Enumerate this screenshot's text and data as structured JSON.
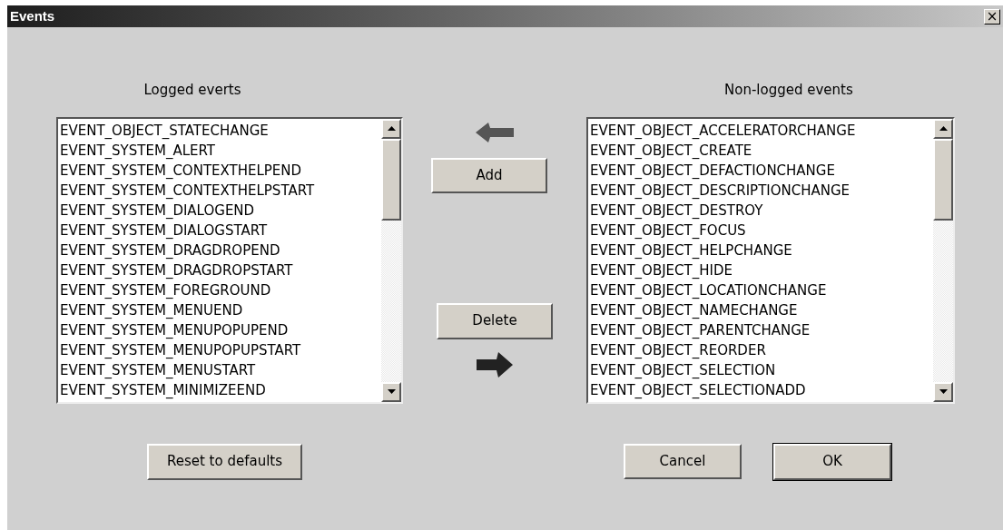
{
  "window": {
    "title": "Events",
    "close": "×"
  },
  "logged": {
    "label": "Logged everts",
    "items": [
      "EVENT_OBJECT_STATECHANGE",
      "EVENT_SYSTEM_ALERT",
      "EVENT_SYSTEM_CONTEXTHELPEND",
      "EVENT_SYSTEM_CONTEXTHELPSTART",
      "EVENT_SYSTEM_DIALOGEND",
      "EVENT_SYSTEM_DIALOGSTART",
      "EVENT_SYSTEM_DRAGDROPEND",
      "EVENT_SYSTEM_DRAGDROPSTART",
      "EVENT_SYSTEM_FOREGROUND",
      "EVENT_SYSTEM_MENUEND",
      "EVENT_SYSTEM_MENUPOPUPEND",
      "EVENT_SYSTEM_MENUPOPUPSTART",
      "EVENT_SYSTEM_MENUSTART",
      "EVENT_SYSTEM_MINIMIZEEND"
    ]
  },
  "non_logged": {
    "label": "Non-logged events",
    "items": [
      "EVENT_OBJECT_ACCELERATORCHANGE",
      "EVENT_OBJECT_CREATE",
      "EVENT_OBJECT_DEFACTIONCHANGE",
      "EVENT_OBJECT_DESCRIPTIONCHANGE",
      "EVENT_OBJECT_DESTROY",
      "EVENT_OBJECT_FOCUS",
      "EVENT_OBJECT_HELPCHANGE",
      "EVENT_OBJECT_HIDE",
      "EVENT_OBJECT_LOCATIONCHANGE",
      "EVENT_OBJECT_NAMECHANGE",
      "EVENT_OBJECT_PARENTCHANGE",
      "EVENT_OBJECT_REORDER",
      "EVENT_OBJECT_SELECTION",
      "EVENT_OBJECT_SELECTIONADD"
    ]
  },
  "buttons": {
    "add": "Add",
    "delete": "Delete",
    "reset": "Reset to defaults",
    "cancel": "Cancel",
    "ok": "OK"
  }
}
